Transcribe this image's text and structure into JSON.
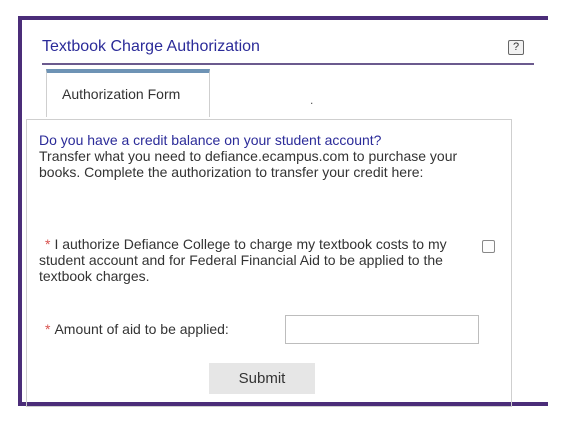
{
  "portlet": {
    "title": "Textbook Charge Authorization",
    "help_label": "?"
  },
  "tabs": [
    {
      "label": "Authorization Form",
      "active": true
    }
  ],
  "tab_bar_dot": ".",
  "form": {
    "question": "Do you have a credit balance on your student account?",
    "intro": "Transfer what you need to defiance.ecampus.com to purchase your books.  Complete the authorization to transfer your credit here:",
    "required_marker": "*",
    "authorization_text": "I authorize Defiance College to charge my textbook costs to my student account and for Federal Financial Aid to be applied to the textbook charges.",
    "authorization_checked": false,
    "amount_label": "Amount of aid to be applied:",
    "amount_value": "",
    "submit_label": "Submit"
  },
  "colors": {
    "frame_border": "#4b2d79",
    "title": "#2b2b99",
    "tab_accent": "#6e93b5",
    "required": "#d9534f"
  }
}
